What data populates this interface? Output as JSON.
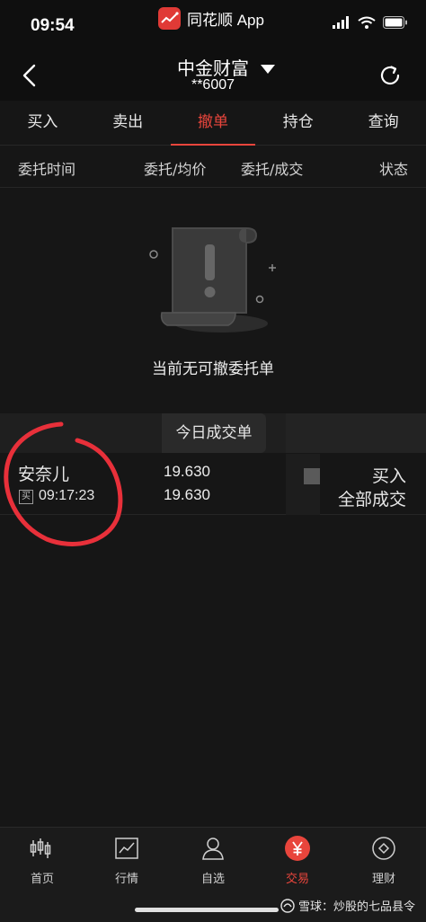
{
  "status_bar": {
    "time": "09:54",
    "app_name": "同花顺 App"
  },
  "header": {
    "title": "中金财富",
    "account": "**6007"
  },
  "tabs": [
    {
      "label": "买入"
    },
    {
      "label": "卖出"
    },
    {
      "label": "撤单",
      "active": true
    },
    {
      "label": "持仓"
    },
    {
      "label": "查询"
    }
  ],
  "columns": {
    "time": "委托时间",
    "price": "委托/均价",
    "qty": "委托/成交",
    "status": "状态"
  },
  "empty_state": {
    "message": "当前无可撤委托单"
  },
  "today": {
    "label": "今日成交单",
    "deal": {
      "name": "安奈儿",
      "badge": "买",
      "time": "09:17:23",
      "price": "19.630",
      "avg_price": "19.630",
      "side": "买入",
      "status": "全部成交"
    }
  },
  "bottom_nav": [
    {
      "label": "首页",
      "icon": "candlestick-icon"
    },
    {
      "label": "行情",
      "icon": "chart-icon"
    },
    {
      "label": "自选",
      "icon": "person-icon"
    },
    {
      "label": "交易",
      "icon": "yen-icon",
      "active": true
    },
    {
      "label": "理财",
      "icon": "coin-icon"
    }
  ],
  "watermark": {
    "text": "雪球：炒股的七品县令"
  },
  "colors": {
    "accent": "#e8453c",
    "background": "#161616",
    "circle_annotation": "#e8303a"
  }
}
